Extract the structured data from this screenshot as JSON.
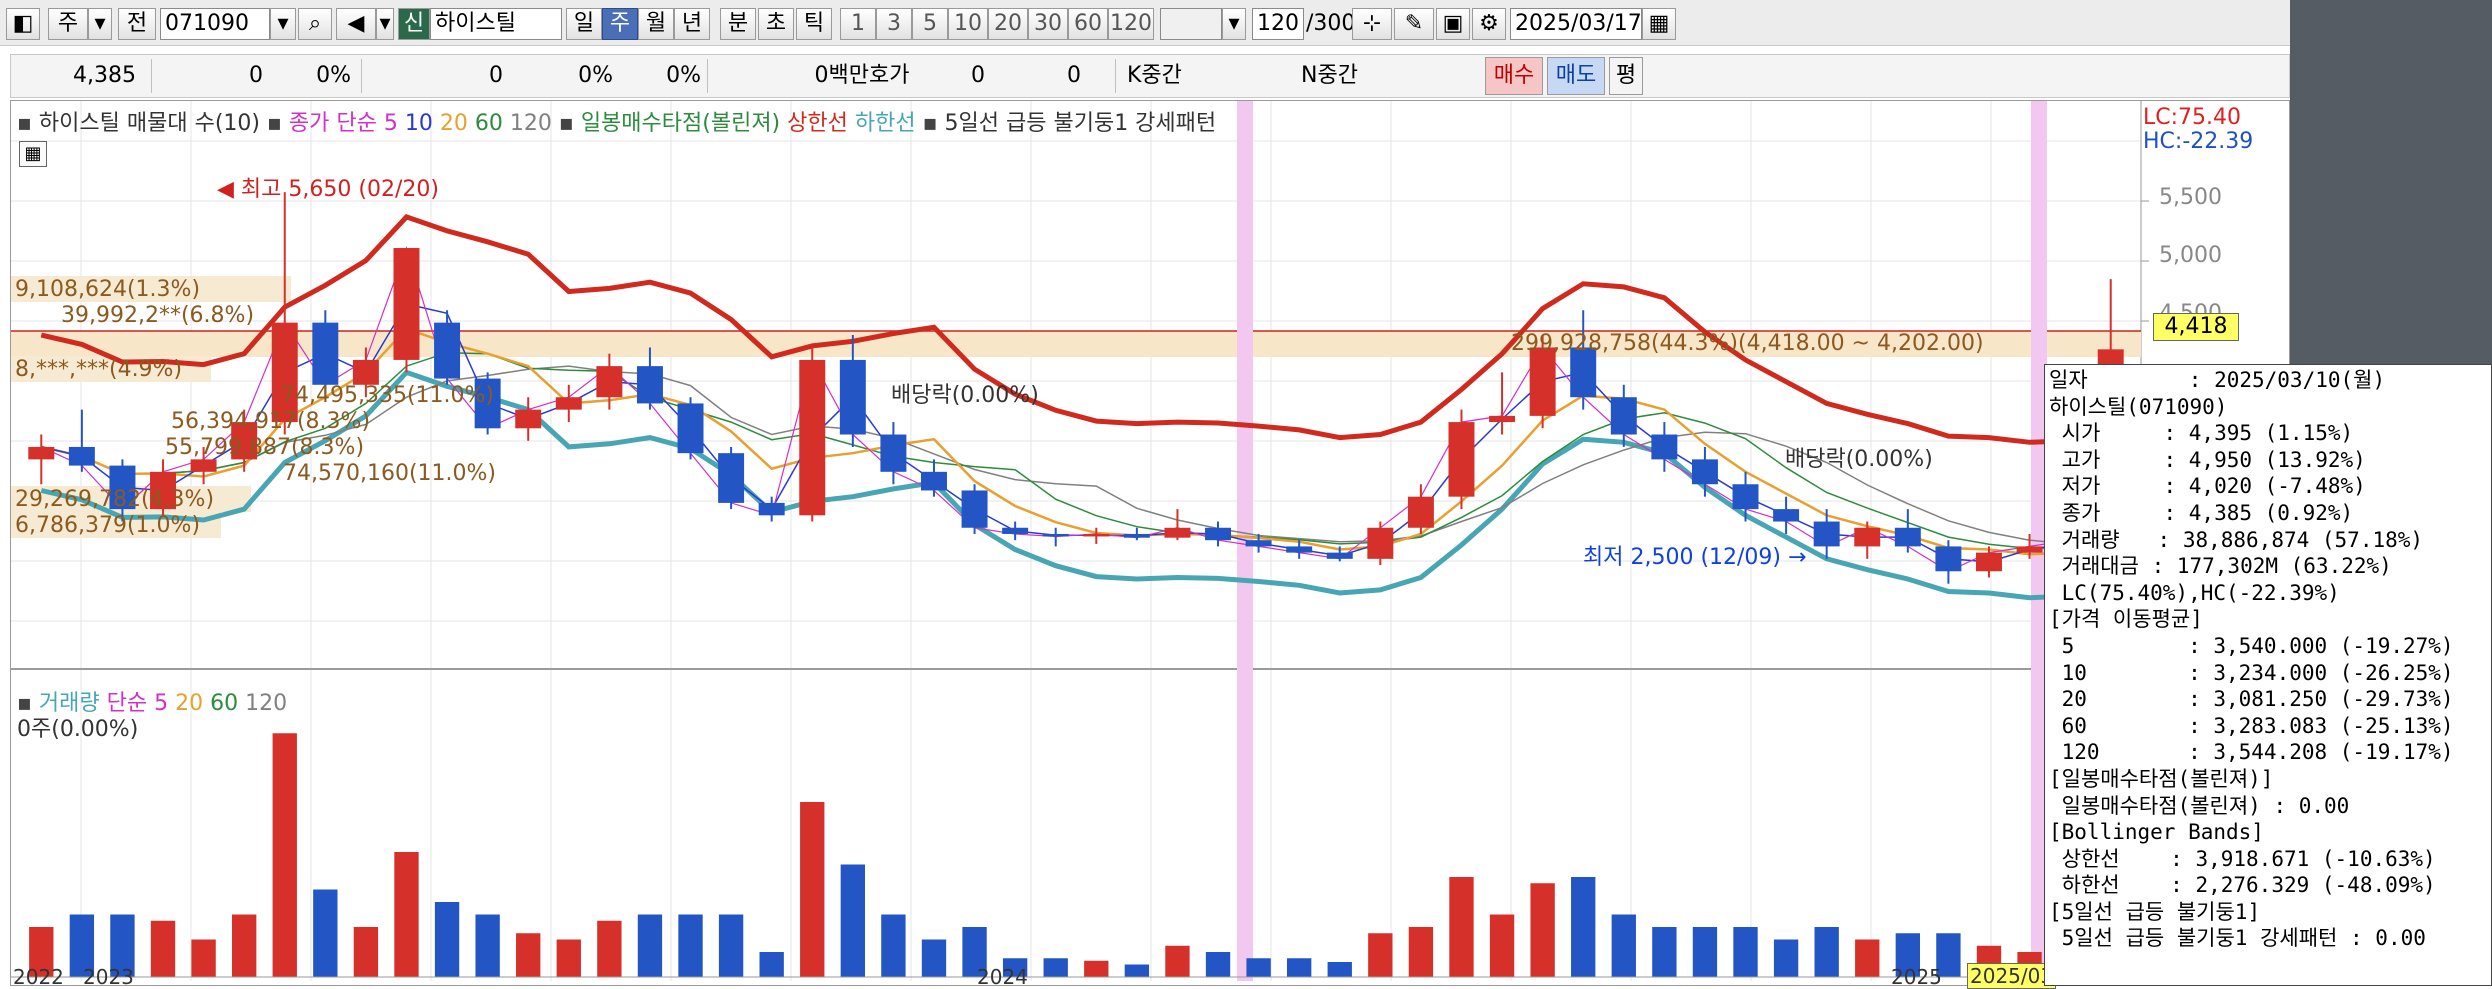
{
  "toolbar": {
    "period_dropdown": "주",
    "prev_label": "전",
    "code_value": "071090",
    "market_badge": "신",
    "stock_name": "하이스틸",
    "tf_buttons": [
      "일",
      "주",
      "월",
      "년",
      "분",
      "초",
      "틱"
    ],
    "tf_selected": "주",
    "interval_buttons": [
      "1",
      "3",
      "5",
      "10",
      "20",
      "30",
      "60",
      "120"
    ],
    "count_value": "120",
    "count_total": "/300",
    "date_value": "2025/03/17"
  },
  "quote": {
    "price": "4,385",
    "change": "0",
    "change_pct": "0%",
    "volume": "0",
    "vol_pct": "0%",
    "pct3": "0%",
    "amount": "0백만",
    "hoga_label": "호가",
    "hoga_v1": "0",
    "hoga_v2": "0",
    "k_label": "K중간",
    "n_label": "N중간",
    "buy_label": "매수",
    "sell_label": "매도",
    "avg_label": "평"
  },
  "price_legend": {
    "title": "하이스틸 매물대 수(10)",
    "close": "종가",
    "simple": "단순",
    "ma5": "5",
    "ma10": "10",
    "ma20": "20",
    "ma60": "60",
    "ma120": "120",
    "bollinger": "일봉매수타점(볼린져)",
    "upper": "상한선",
    "lower": "하한선",
    "pattern": "5일선 급등 불기둥1 강세패턴"
  },
  "lc_hc": {
    "lc": "LC:75.40",
    "hc": "HC:-22.39"
  },
  "price_axis": {
    "ticks": [
      "5,500",
      "5,000",
      "4,500"
    ],
    "current": "4,418"
  },
  "annotations": {
    "high": "최고 5,650 (02/20)",
    "low": "최저 2,500 (12/09)",
    "div1": "배당락(0.00%)",
    "div2": "배당락(0.00%)",
    "current_box": "299,928,758(44.3%)(4,418.00 ~ 4,202.00)"
  },
  "volume_profile": [
    "9,108,624(1.3%)",
    "39,992,2**(6.8%)",
    "8,***,***(4.9%)",
    "74,495,335(11.0%)",
    "56,394,917(8.3%)",
    "55,799,887(8.3%)",
    "74,570,160(11.0%)",
    "29,269,782(4.3%)",
    "6,786,379(1.0%)"
  ],
  "volume_legend": {
    "title": "거래량",
    "simple": "단순",
    "ma5": "5",
    "ma20": "20",
    "ma60": "60",
    "ma120": "120",
    "zero": "0주(0.00%)"
  },
  "x_axis": [
    "2022",
    "2023",
    "2024",
    "2025",
    "2025/03"
  ],
  "colors": {
    "up": "#d5312a",
    "down": "#2356c4",
    "boll": "#48a6b4",
    "upper": "#d02a1e",
    "ma20": "#e8a030",
    "ma60": "#2e8b3e",
    "ma120": "#808080",
    "ma5": "#d030c8",
    "ma10": "#2a3ad0"
  },
  "chart_data": {
    "type": "candlestick",
    "title": "하이스틸",
    "ohlc_weekly_approx": [
      [
        3500,
        3700,
        3300,
        3600
      ],
      [
        3600,
        3900,
        3400,
        3450
      ],
      [
        3450,
        3500,
        3000,
        3100
      ],
      [
        3100,
        3500,
        3050,
        3400
      ],
      [
        3400,
        3600,
        3300,
        3500
      ],
      [
        3500,
        3900,
        3400,
        3800
      ],
      [
        3800,
        5650,
        3700,
        4600
      ],
      [
        4600,
        4700,
        4000,
        4100
      ],
      [
        4100,
        4400,
        4000,
        4300
      ],
      [
        4300,
        5200,
        4200,
        5200
      ],
      [
        4600,
        4700,
        4100,
        4150
      ],
      [
        4150,
        4200,
        3700,
        3750
      ],
      [
        3750,
        4000,
        3650,
        3900
      ],
      [
        3900,
        4100,
        3800,
        4000
      ],
      [
        4000,
        4350,
        3900,
        4250
      ],
      [
        4250,
        4400,
        3900,
        3950
      ],
      [
        3950,
        4000,
        3500,
        3550
      ],
      [
        3550,
        3600,
        3100,
        3150
      ],
      [
        3150,
        3200,
        3000,
        3050
      ],
      [
        3050,
        4400,
        3000,
        4300
      ],
      [
        4300,
        4500,
        3600,
        3700
      ],
      [
        3700,
        3800,
        3300,
        3400
      ],
      [
        3400,
        3500,
        3200,
        3250
      ],
      [
        3250,
        3300,
        2900,
        2950
      ],
      [
        2950,
        3000,
        2850,
        2900
      ],
      [
        2900,
        2950,
        2800,
        2880
      ],
      [
        2880,
        2950,
        2820,
        2900
      ],
      [
        2900,
        2950,
        2850,
        2870
      ],
      [
        2870,
        3100,
        2850,
        2950
      ],
      [
        2950,
        3000,
        2800,
        2850
      ],
      [
        2850,
        2900,
        2750,
        2800
      ],
      [
        2800,
        2850,
        2700,
        2750
      ],
      [
        2750,
        2800,
        2680,
        2700
      ],
      [
        2700,
        3000,
        2650,
        2950
      ],
      [
        2950,
        3300,
        2900,
        3200
      ],
      [
        3200,
        3900,
        3100,
        3800
      ],
      [
        3800,
        4200,
        3700,
        3850
      ],
      [
        3850,
        4500,
        3750,
        4400
      ],
      [
        4400,
        4700,
        3900,
        4000
      ],
      [
        4000,
        4100,
        3600,
        3700
      ],
      [
        3700,
        3800,
        3400,
        3500
      ],
      [
        3500,
        3600,
        3200,
        3300
      ],
      [
        3300,
        3400,
        3000,
        3100
      ],
      [
        3100,
        3200,
        2900,
        3000
      ],
      [
        3000,
        3100,
        2700,
        2800
      ],
      [
        2800,
        3000,
        2700,
        2950
      ],
      [
        2950,
        3100,
        2750,
        2800
      ],
      [
        2800,
        2850,
        2500,
        2600
      ],
      [
        2600,
        2800,
        2550,
        2750
      ],
      [
        2750,
        2900,
        2700,
        2800
      ],
      [
        2800,
        2900,
        2700,
        2850
      ],
      [
        2850,
        4950,
        2800,
        4385
      ]
    ],
    "ylim": [
      2200,
      5900
    ]
  }
}
